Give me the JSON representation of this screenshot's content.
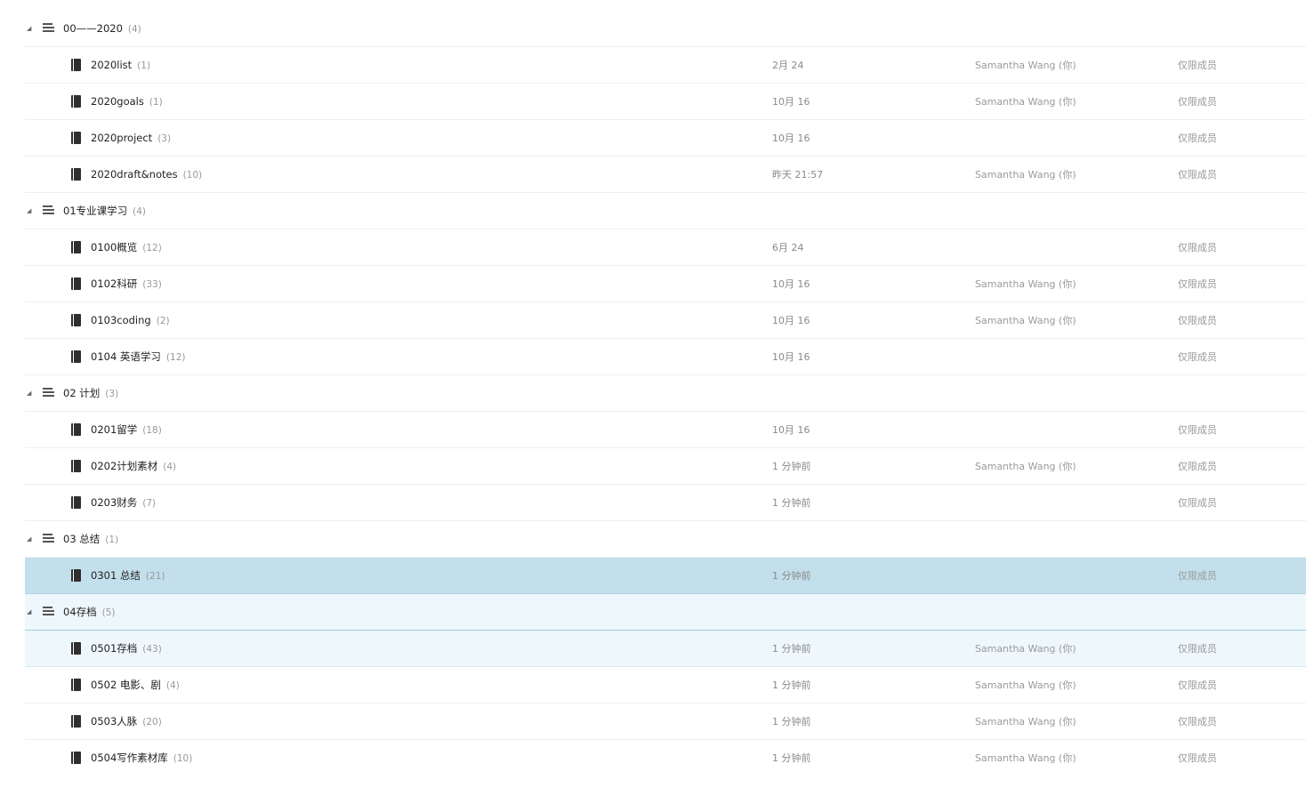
{
  "rows": [
    {
      "type": "stack",
      "name": "00——2020",
      "count": "(4)"
    },
    {
      "type": "notebook",
      "name": "2020list",
      "count": "(1)",
      "date": "2月 24",
      "owner": "Samantha Wang (你)",
      "share": "仅限成员"
    },
    {
      "type": "notebook",
      "name": "2020goals",
      "count": "(1)",
      "date": "10月 16",
      "owner": "Samantha Wang (你)",
      "share": "仅限成员"
    },
    {
      "type": "notebook",
      "name": "2020project",
      "count": "(3)",
      "date": "10月 16",
      "owner": "",
      "share": "仅限成员"
    },
    {
      "type": "notebook",
      "name": "2020draft&notes",
      "count": "(10)",
      "date": "昨天 21:57",
      "owner": "Samantha Wang (你)",
      "share": "仅限成员"
    },
    {
      "type": "stack",
      "name": "01专业课学习",
      "count": "(4)"
    },
    {
      "type": "notebook",
      "name": "0100概览",
      "count": "(12)",
      "date": "6月 24",
      "owner": "",
      "share": "仅限成员"
    },
    {
      "type": "notebook",
      "name": "0102科研",
      "count": "(33)",
      "date": "10月 16",
      "owner": "Samantha Wang (你)",
      "share": "仅限成员"
    },
    {
      "type": "notebook",
      "name": "0103coding",
      "count": "(2)",
      "date": "10月 16",
      "owner": "Samantha Wang (你)",
      "share": "仅限成员"
    },
    {
      "type": "notebook",
      "name": "0104 英语学习",
      "count": "(12)",
      "date": "10月 16",
      "owner": "",
      "share": "仅限成员"
    },
    {
      "type": "stack",
      "name": "02 计划",
      "count": "(3)"
    },
    {
      "type": "notebook",
      "name": "0201留学",
      "count": "(18)",
      "date": "10月 16",
      "owner": "",
      "share": "仅限成员"
    },
    {
      "type": "notebook",
      "name": "0202计划素材",
      "count": "(4)",
      "date": "1 分钟前",
      "owner": "Samantha Wang (你)",
      "share": "仅限成员"
    },
    {
      "type": "notebook",
      "name": "0203财务",
      "count": "(7)",
      "date": "1 分钟前",
      "owner": "",
      "share": "仅限成员"
    },
    {
      "type": "stack",
      "name": "03 总结",
      "count": "(1)"
    },
    {
      "type": "notebook",
      "name": "0301 总结",
      "count": "(21)",
      "date": "1 分钟前",
      "owner": "",
      "share": "仅限成员"
    },
    {
      "type": "stack",
      "name": "04存档",
      "count": "(5)"
    },
    {
      "type": "notebook",
      "name": "0501存档",
      "count": "(43)",
      "date": "1 分钟前",
      "owner": "Samantha Wang (你)",
      "share": "仅限成员"
    },
    {
      "type": "notebook",
      "name": "0502 电影、剧",
      "count": "(4)",
      "date": "1 分钟前",
      "owner": "Samantha Wang (你)",
      "share": "仅限成员"
    },
    {
      "type": "notebook",
      "name": "0503人脉",
      "count": "(20)",
      "date": "1 分钟前",
      "owner": "Samantha Wang (你)",
      "share": "仅限成员"
    },
    {
      "type": "notebook",
      "name": "0504写作素材库",
      "count": "(10)",
      "date": "1 分钟前",
      "owner": "Samantha Wang (你)",
      "share": "仅限成员"
    }
  ],
  "icons": {
    "expand": "caret-down-icon",
    "stack": "stack-icon",
    "notebook": "notebook-icon"
  },
  "colors": {
    "selected_row": "#c3dfec",
    "hover_row": "#eef7fc"
  }
}
